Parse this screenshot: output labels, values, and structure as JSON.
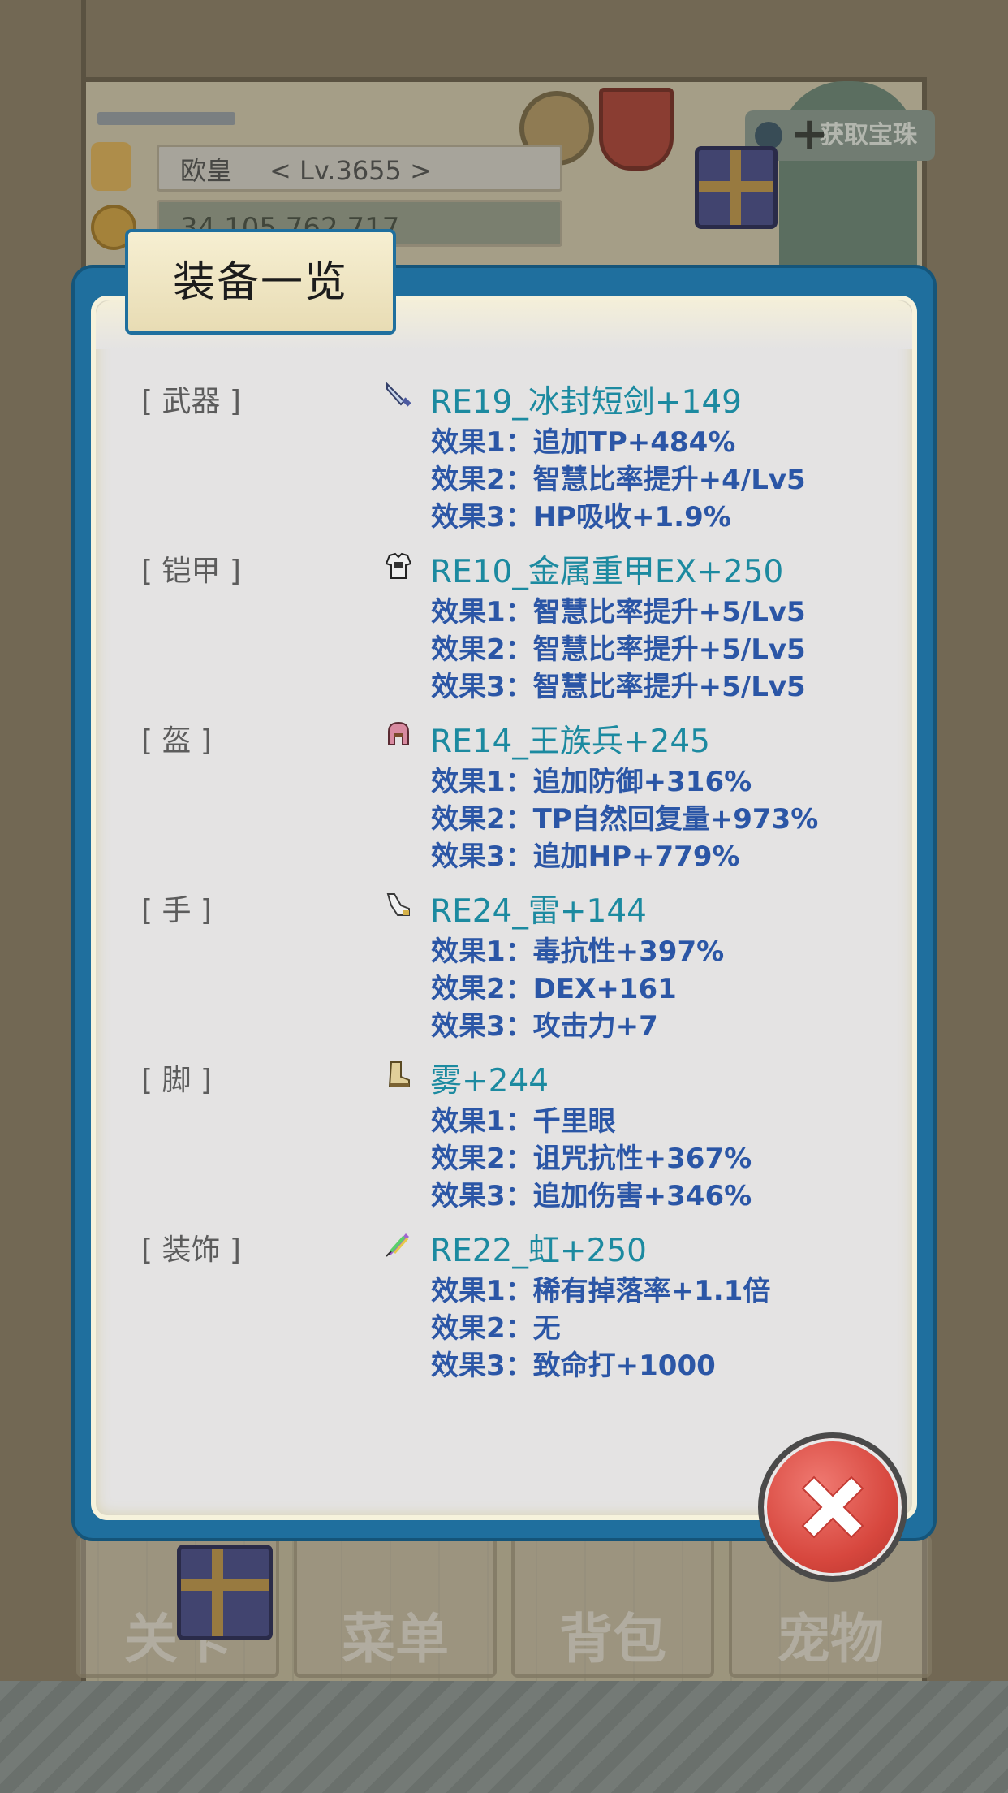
{
  "header": {
    "player_name": "欧皇",
    "level": "< Lv.3655 >",
    "gold": "34,105,762,717",
    "get_button_label": "获取宝珠"
  },
  "dialog": {
    "title": "装备一览",
    "slots": [
      {
        "label": "[ 武器 ]",
        "icon": "sword-icon",
        "item": "RE19_冰封短剑+149",
        "effects": [
          "效果1：追加TP+484%",
          "效果2：智慧比率提升+4/Lv5",
          "效果3：HP吸收+1.9%"
        ]
      },
      {
        "label": "[ 铠甲 ]",
        "icon": "armor-icon",
        "item": "RE10_金属重甲EX+250",
        "effects": [
          "效果1：智慧比率提升+5/Lv5",
          "效果2：智慧比率提升+5/Lv5",
          "效果3：智慧比率提升+5/Lv5"
        ]
      },
      {
        "label": "[ 盔 ]",
        "icon": "helmet-icon",
        "item": "RE14_王族兵+245",
        "effects": [
          "效果1：追加防御+316%",
          "效果2：TP自然回复量+973%",
          "效果3：追加HP+779%"
        ]
      },
      {
        "label": "[ 手 ]",
        "icon": "glove-icon",
        "item": "RE24_雷+144",
        "effects": [
          "效果1：毒抗性+397%",
          "效果2：DEX+161",
          "效果3：攻击力+7"
        ]
      },
      {
        "label": "[ 脚 ]",
        "icon": "boot-icon",
        "item": "雾+244",
        "effects": [
          "效果1：千里眼",
          "效果2：诅咒抗性+367%",
          "效果3：追加伤害+346%"
        ]
      },
      {
        "label": "[ 装饰 ]",
        "icon": "feather-icon",
        "item": "RE22_虹+250",
        "effects": [
          "效果1：稀有掉落率+1.1倍",
          "效果2：无",
          "效果3：致命打+1000"
        ]
      }
    ]
  },
  "nav": {
    "items": [
      "关卡",
      "菜单",
      "背包",
      "宠物"
    ]
  },
  "colors": {
    "panel_border": "#1f6f9e",
    "item_name": "#1c8aa0",
    "effect_text": "#2b56a6",
    "close_button": "#d7473e"
  }
}
